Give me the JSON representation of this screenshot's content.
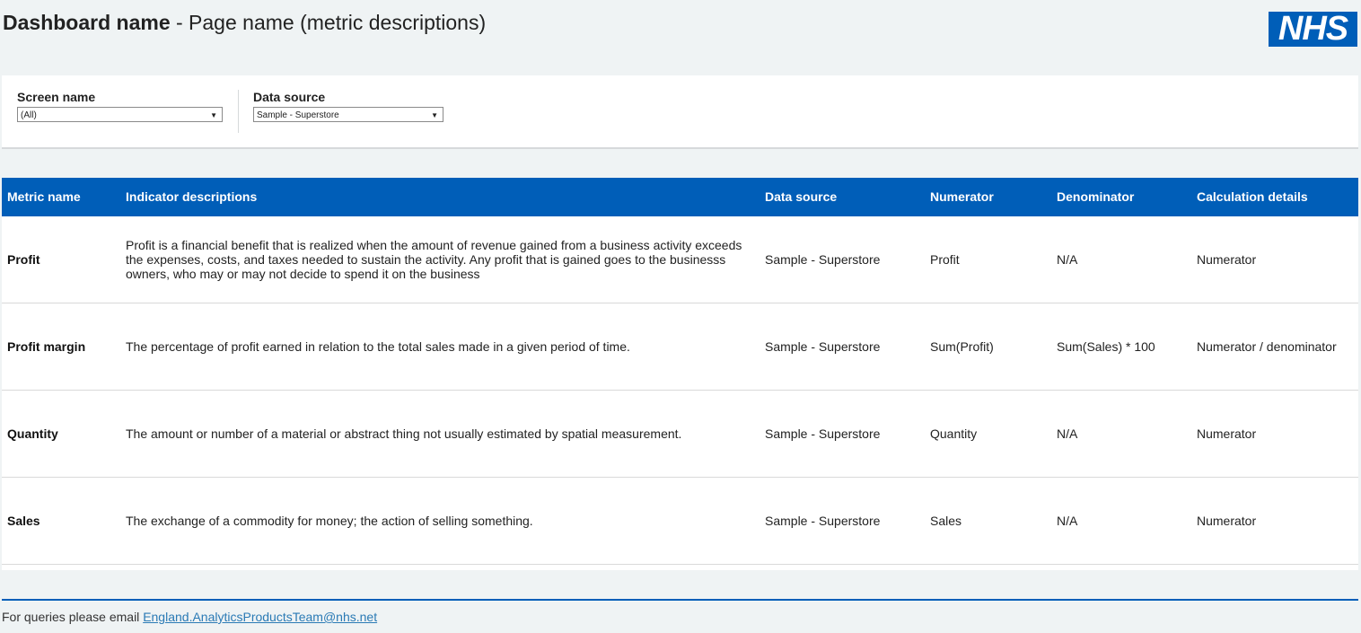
{
  "header": {
    "dashboard_name": "Dashboard name",
    "page_name": " - Page name (metric descriptions)",
    "logo_text": "NHS"
  },
  "filters": {
    "screen": {
      "label": "Screen name",
      "value": "(All)"
    },
    "source": {
      "label": "Data source",
      "value": "Sample - Superstore"
    }
  },
  "table": {
    "headers": [
      "Metric name",
      "Indicator descriptions",
      "Data source",
      "Numerator",
      "Denominator",
      "Calculation details"
    ],
    "rows": [
      {
        "metric": "Profit",
        "description": "Profit is a financial benefit that is realized when the amount of revenue gained from a business activity exceeds the expenses, costs, and taxes needed to sustain the activity. Any profit that is gained goes to the businesss owners, who may or may not decide to spend it on the business",
        "source": "Sample - Superstore",
        "numerator": "Profit",
        "denominator": "N/A",
        "calculation": "Numerator"
      },
      {
        "metric": "Profit margin",
        "description": "The percentage of profit earned in relation to the total sales made in a given period of time.",
        "source": "Sample - Superstore",
        "numerator": "Sum(Profit)",
        "denominator": "Sum(Sales) * 100",
        "calculation": "Numerator / denominator"
      },
      {
        "metric": "Quantity",
        "description": "The amount or number of a material or abstract thing not usually estimated by spatial measurement.",
        "source": "Sample - Superstore",
        "numerator": "Quantity",
        "denominator": "N/A",
        "calculation": "Numerator"
      },
      {
        "metric": "Sales",
        "description": "The exchange of a commodity for money; the action of selling something.",
        "source": "Sample - Superstore",
        "numerator": "Sales",
        "denominator": "N/A",
        "calculation": "Numerator"
      }
    ]
  },
  "footer": {
    "text": "For queries please email ",
    "email": "England.AnalyticsProductsTeam@nhs.net"
  },
  "colors": {
    "nhs_blue": "#005eb8",
    "background": "#eff3f4"
  }
}
